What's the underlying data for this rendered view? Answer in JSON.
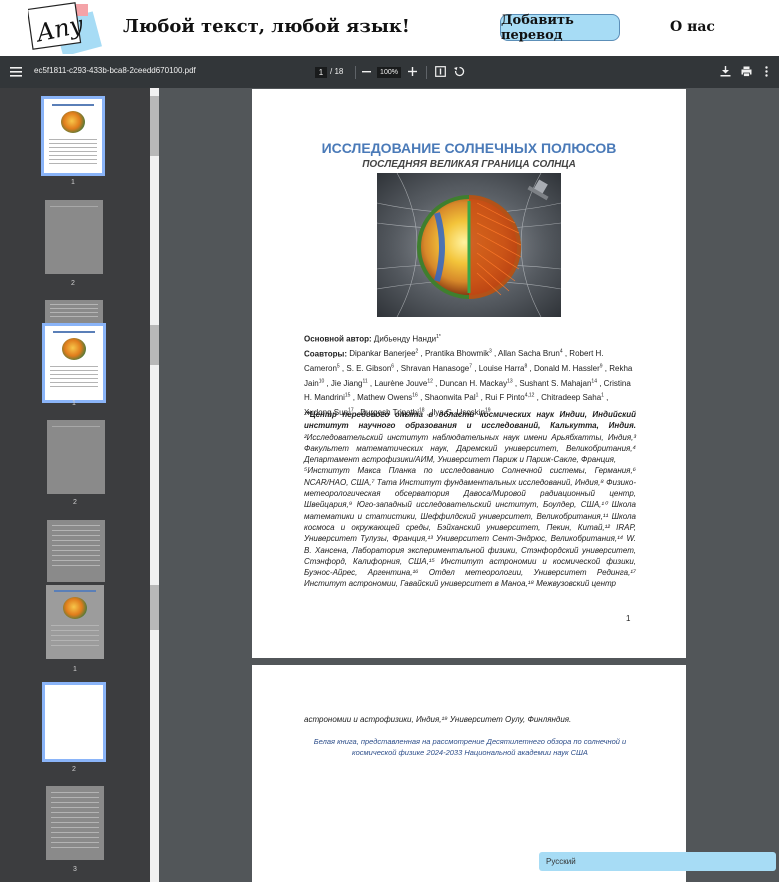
{
  "site": {
    "logo_text": "Any",
    "tagline": "Любой текст, любой язык!",
    "add_translation_label": "Добавить перевод",
    "about_label": "О нас"
  },
  "toolbar": {
    "filename": "ec5f1811-c293-433b-bca8-2ceedd670100.pdf",
    "current_page": "1",
    "total_pages": "/ 18",
    "zoom": "100%",
    "icons": [
      "menu-icon",
      "zoom-out-icon",
      "zoom-in-icon",
      "fit-page-icon",
      "rotate-icon",
      "download-icon",
      "print-icon",
      "more-icon"
    ]
  },
  "sidebar": {
    "thumbnails": [
      {
        "label": "1",
        "selected": true
      },
      {
        "label": "2",
        "selected": false
      },
      {
        "label": "1",
        "selected": true
      },
      {
        "label": "2",
        "selected": false
      },
      {
        "label": "1",
        "selected": false
      },
      {
        "label": "2",
        "selected": true
      },
      {
        "label": "3",
        "selected": false
      }
    ]
  },
  "document": {
    "title": "ИССЛЕДОВАНИЕ СОЛНЕЧНЫХ ПОЛЮСОВ",
    "subtitle": "ПОСЛЕДНЯЯ ВЕЛИКАЯ ГРАНИЦА СОЛНЦА",
    "lead_author_label": "Основной автор:",
    "lead_author": "Дибьенду Нанди",
    "lead_author_sup": "1*",
    "coauthors_label": "Соавторы:",
    "coauthors": [
      {
        "name": "Dipankar Banerjee",
        "sup": "2"
      },
      {
        "name": "Prantika Bhowmik",
        "sup": "3"
      },
      {
        "name": "Allan Sacha Brun",
        "sup": "4"
      },
      {
        "name": "Robert H. Cameron",
        "sup": "5"
      },
      {
        "name": "S. E. Gibson",
        "sup": "6"
      },
      {
        "name": "Shravan Hanasoge",
        "sup": "7"
      },
      {
        "name": "Louise Harra",
        "sup": "8"
      },
      {
        "name": "Donald M. Hassler",
        "sup": "9"
      },
      {
        "name": "Rekha Jain",
        "sup": "10"
      },
      {
        "name": "Jie Jiang",
        "sup": "11"
      },
      {
        "name": "Laurène Jouve",
        "sup": "12"
      },
      {
        "name": "Duncan H. Mackay",
        "sup": "13"
      },
      {
        "name": "Sushant S. Mahajan",
        "sup": "14"
      },
      {
        "name": "Cristina H. Mandrini",
        "sup": "15"
      },
      {
        "name": "Mathew Owens",
        "sup": "16"
      },
      {
        "name": "Shaonwita Pal",
        "sup": "1"
      },
      {
        "name": "Rui F Pinto",
        "sup": "4,12"
      },
      {
        "name": "Chitradeep Saha",
        "sup": "1"
      },
      {
        "name": "Xudong Sun",
        "sup": "17"
      },
      {
        "name": "Durgesh Tripathi",
        "sup": "18"
      },
      {
        "name": "Ilya G. Usoskin",
        "sup": "19"
      }
    ],
    "affil_bold": "¹*Центр передового опыта в области космических наук Индии, Индийский институт научного образования и исследований, Калькутта, Индия.",
    "affil_text_1": "²Исследовательский институт наблюдательных наук имени Арьябхатты, Индия,³ Факультет математических наук, Даремский университет, Великобритания,⁴ Департамент астрофизики/АИМ, Университет Париж и Париж-Сакле, Франция,",
    "affil_text_2": "⁵Институт Макса Планка по исследованию Солнечной системы, Германия,⁶ NCAR/HAO, США,⁷ Тата Институт фундаментальных исследований, Индия,⁸ Физико-метеорологическая обсерватория Давоса/Мировой радиационный центр, Швейцария,⁹ Юго-западный исследовательский институт, Боулдер, США,¹⁰ Школа математики и статистики, Шеффилдский университет, Великобритания,¹¹ Школа космоса и окружающей среды, Бэйханский университет, Пекин, Китай,¹² IRAP, Университет Тулузы, Франция,¹³ Университет Сент-Эндрюс, Великобритания,¹⁴ W. В. Хансена, Лаборатория экспериментальной физики, Стэнфордский университет, Стэнфорд, Калифорния, США,¹⁵ Институт астрономии и космической физики, Буэнос-Айрес, Аргентина,¹⁶ Отдел метеорологии, Университет Рединга,¹⁷ Институт астрономии, Гавайский университет в Маноа,¹⁸ Межвузовский центр",
    "page1_number": "1",
    "page2_line": "астрономии и астрофизики, Индия,¹⁹ Университет Оулу, Финляндия.",
    "page2_note": "Белая книга, представленная на рассмотрение Десятилетнего обзора по солнечной и космической физике 2024-2033 Национальной академии наук США"
  },
  "language": {
    "selected": "Русский"
  }
}
